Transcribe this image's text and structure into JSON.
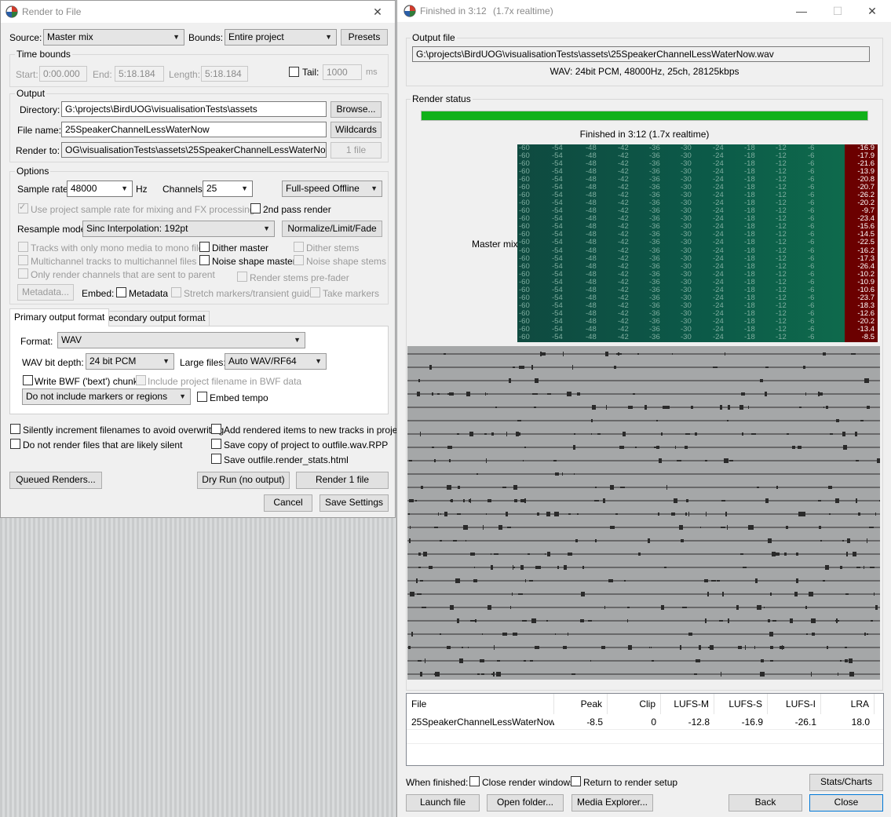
{
  "render_window": {
    "title": "Render to File",
    "source_label": "Source:",
    "source_value": "Master mix",
    "bounds_label": "Bounds:",
    "bounds_value": "Entire project",
    "presets_button": "Presets",
    "time_bounds_group": "Time bounds",
    "start_label": "Start:",
    "start_value": "0:00.000",
    "end_label": "End:",
    "end_value": "5:18.184",
    "length_label": "Length:",
    "length_value": "5:18.184",
    "tail_label": "Tail:",
    "tail_value": "1000",
    "tail_unit": "ms",
    "output_group": "Output",
    "directory_label": "Directory:",
    "directory_value": "G:\\projects\\BirdUOG\\visualisationTests\\assets",
    "browse_button": "Browse...",
    "filename_label": "File name:",
    "filename_value": "25SpeakerChannelLessWaterNow",
    "wildcards_button": "Wildcards",
    "renderto_label": "Render to:",
    "renderto_value": "OG\\visualisationTests\\assets\\25SpeakerChannelLessWaterNow.wav",
    "files_button": "1 file",
    "options_group": "Options",
    "samplerate_label": "Sample rate:",
    "samplerate_value": "48000",
    "samplerate_unit": "Hz",
    "channels_label": "Channels:",
    "channels_value": "25",
    "speed_value": "Full-speed Offline",
    "use_project_rate": "Use project sample rate for mixing and FX processing",
    "second_pass": "2nd pass render",
    "resample_label": "Resample mode:",
    "resample_value": "Sinc Interpolation: 192pt",
    "normalize_button": "Normalize/Limit/Fade",
    "tracks_mono": "Tracks with only mono media to mono file",
    "dither_master": "Dither master",
    "dither_stems": "Dither stems",
    "multichannel": "Multichannel tracks to multichannel files",
    "noise_master": "Noise shape master",
    "noise_stems": "Noise shape stems",
    "only_render_channels": "Only render channels that are sent to parent",
    "render_stems_prefader": "Render stems pre-fader",
    "metadata_button": "Metadata...",
    "embed_label": "Embed:",
    "embed_metadata": "Metadata",
    "embed_stretch": "Stretch markers/transient guides",
    "embed_take": "Take markers",
    "tab_primary": "Primary output format",
    "tab_secondary": "Secondary output format",
    "format_label": "Format:",
    "format_value": "WAV",
    "bitdepth_label": "WAV bit depth:",
    "bitdepth_value": "24 bit PCM",
    "largefiles_label": "Large files:",
    "largefiles_value": "Auto WAV/RF64",
    "write_bwf": "Write BWF ('bext') chunk",
    "include_filename_bwf": "Include project filename in BWF data",
    "markers_value": "Do not include markers or regions",
    "embed_tempo": "Embed tempo",
    "silently_increment": "Silently increment filenames to avoid overwriting",
    "add_rendered": "Add rendered items to new tracks in project",
    "do_not_render_silent": "Do not render files that are likely silent",
    "save_copy": "Save copy of project to outfile.wav.RPP",
    "save_stats": "Save outfile.render_stats.html",
    "queued_button": "Queued Renders...",
    "dryrun_button": "Dry Run (no output)",
    "render_button": "Render 1 file",
    "cancel_button": "Cancel",
    "save_settings_button": "Save Settings"
  },
  "finished_window": {
    "title": "Finished in 3:12",
    "title_extra": "(1.7x realtime)",
    "output_file_group": "Output file",
    "output_path": "G:\\projects\\BirdUOG\\visualisationTests\\assets\\25SpeakerChannelLessWaterNow.wav",
    "format_info": "WAV: 24bit PCM, 48000Hz, 25ch, 28125kbps",
    "render_status_group": "Render status",
    "progress": 1.0,
    "progress_color": "#11b11a",
    "status_text": "Finished in 3:12    (1.7x realtime)",
    "meter_label": "Master mix",
    "meter_scale": [
      "-60",
      "-54",
      "-48",
      "-42",
      "-36",
      "-30",
      "-24",
      "-18",
      "-12",
      "-6"
    ],
    "peaks": [
      "-16.9",
      "-17.9",
      "-21.6",
      "-13.9",
      "-20.8",
      "-20.7",
      "-26.2",
      "-20.2",
      "-9.7",
      "-23.4",
      "-15.6",
      "-14.5",
      "-22.5",
      "-16.2",
      "-17.3",
      "-26.4",
      "-10.2",
      "-10.9",
      "-10.6",
      "-23.7",
      "-18.3",
      "-12.6",
      "-20.2",
      "-13.4",
      "-8.5"
    ],
    "stats_headers": [
      "File",
      "Peak",
      "Clip",
      "LUFS-M",
      "LUFS-S",
      "LUFS-I",
      "LRA"
    ],
    "stats_row": [
      "25SpeakerChannelLessWaterNow....",
      "-8.5",
      "0",
      "-12.8",
      "-16.9",
      "-26.1",
      "18.0"
    ],
    "when_finished_label": "When finished:",
    "close_windows": "Close render windows",
    "return_setup": "Return to render setup",
    "stats_button": "Stats/Charts",
    "launch_button": "Launch file",
    "open_folder_button": "Open folder...",
    "media_explorer_button": "Media Explorer...",
    "back_button": "Back",
    "close_button": "Close"
  }
}
